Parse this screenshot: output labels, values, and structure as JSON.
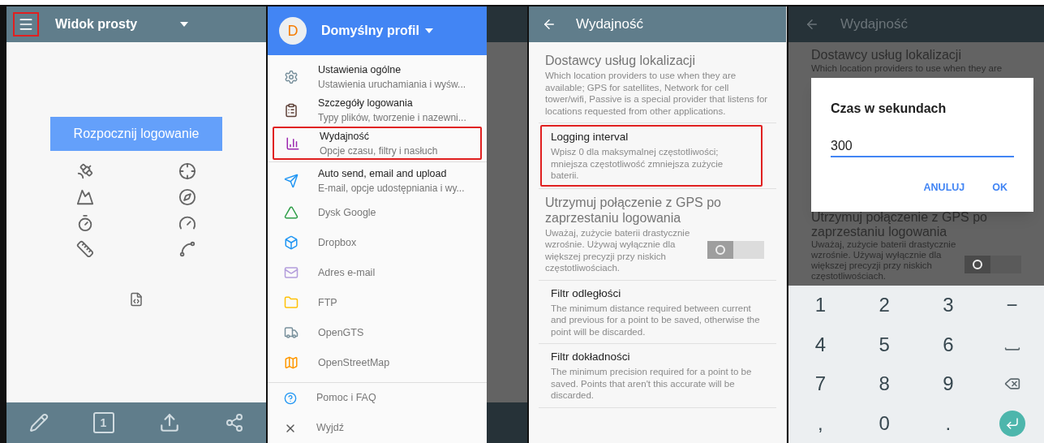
{
  "main_screen": {
    "title": "Widok prosty",
    "menu_highlighted": true,
    "start_button": "Rozpocznij logowanie",
    "bottom_bar": {
      "counter": "1"
    }
  },
  "drawer": {
    "avatar_letter": "D",
    "profile": "Domyślny profil",
    "items": [
      {
        "kind": "two-line",
        "title": "Ustawienia ogólne",
        "subtitle": "Ustawienia uruchamiania i wyśw...",
        "highlighted": false
      },
      {
        "kind": "two-line",
        "title": "Szczegóły logowania",
        "subtitle": "Typy plików, tworzenie i nazewni...",
        "highlighted": false
      },
      {
        "kind": "two-line",
        "title": "Wydajność",
        "subtitle": "Opcje czasu, filtry i nasłuch",
        "highlighted": true
      },
      {
        "kind": "two-line",
        "title": "Auto send, email and upload",
        "subtitle": "E-mail, opcje udostępniania i wy...",
        "highlighted": false
      },
      {
        "kind": "single",
        "title": "Dysk Google",
        "highlighted": false
      },
      {
        "kind": "single",
        "title": "Dropbox",
        "highlighted": false
      },
      {
        "kind": "single",
        "title": "Adres e-mail",
        "highlighted": false
      },
      {
        "kind": "single",
        "title": "FTP",
        "highlighted": false
      },
      {
        "kind": "single",
        "title": "OpenGTS",
        "highlighted": false
      },
      {
        "kind": "single",
        "title": "OpenStreetMap",
        "highlighted": false
      }
    ],
    "footer_items": [
      {
        "title": "Pomoc i FAQ"
      },
      {
        "title": "Wyjdź"
      }
    ]
  },
  "settings_screen": {
    "title": "Wydajność",
    "items": [
      {
        "kind": "large",
        "title": "Dostawcy usług lokalizacji",
        "description": "Which location providers to use when they are available; GPS for satellites, Network for cell tower/wifi, Passive is a special provider that listens for locations requested from other applications.",
        "highlighted": false
      },
      {
        "kind": "normal",
        "title": "Logging interval",
        "description": "Wpisz 0 dla maksymalnej częstotliwości; mniejsza częstotliwość zmniejsza zużycie baterii.",
        "highlighted": true
      },
      {
        "kind": "large",
        "title": "Utrzymuj połączenie z GPS po zaprzestaniu logowania",
        "description": "Uważaj, zużycie baterii drastycznie wzrośnie. Używaj wyłącznie dla większej precyzji przy niskich częstotliwościach.",
        "highlighted": false,
        "on": false
      },
      {
        "kind": "normal",
        "title": "Filtr odległości",
        "description": "The minimum distance required between current and previous for a point to be saved, otherwise the point will be discarded.",
        "highlighted": false
      },
      {
        "kind": "normal",
        "title": "Filtr dokładności",
        "description": "The minimum precision required for a point to be saved. Points that aren't this accurate will be discarded.",
        "highlighted": false
      }
    ]
  },
  "dialog_screen": {
    "title": "Wydajność",
    "background_items": [
      {
        "title": "Dostawcy usług lokalizacji",
        "description": "Which location providers to use when they are"
      },
      {
        "title": "Utrzymuj połączenie z GPS po zaprzestaniu logowania",
        "description": "Uważaj, zużycie baterii drastycznie wzrośnie. Używaj wyłącznie dla większej precyzji przy niskich częstotliwościach.",
        "on": false
      }
    ],
    "dialog": {
      "title": "Czas w sekundach",
      "value": "300",
      "buttons": [
        "ANULUJ",
        "OK"
      ]
    },
    "keyboard": [
      {
        "kind": "char",
        "label": "1"
      },
      {
        "kind": "char",
        "label": "2"
      },
      {
        "kind": "char",
        "label": "3"
      },
      {
        "kind": "char",
        "label": "−"
      },
      {
        "kind": "char",
        "label": "4"
      },
      {
        "kind": "char",
        "label": "5"
      },
      {
        "kind": "char",
        "label": "6"
      },
      {
        "kind": "space"
      },
      {
        "kind": "char",
        "label": "7"
      },
      {
        "kind": "char",
        "label": "8"
      },
      {
        "kind": "char",
        "label": "9"
      },
      {
        "kind": "backspace"
      },
      {
        "kind": "char",
        "label": ","
      },
      {
        "kind": "char",
        "label": "0"
      },
      {
        "kind": "char",
        "label": "."
      },
      {
        "kind": "enter"
      }
    ]
  }
}
